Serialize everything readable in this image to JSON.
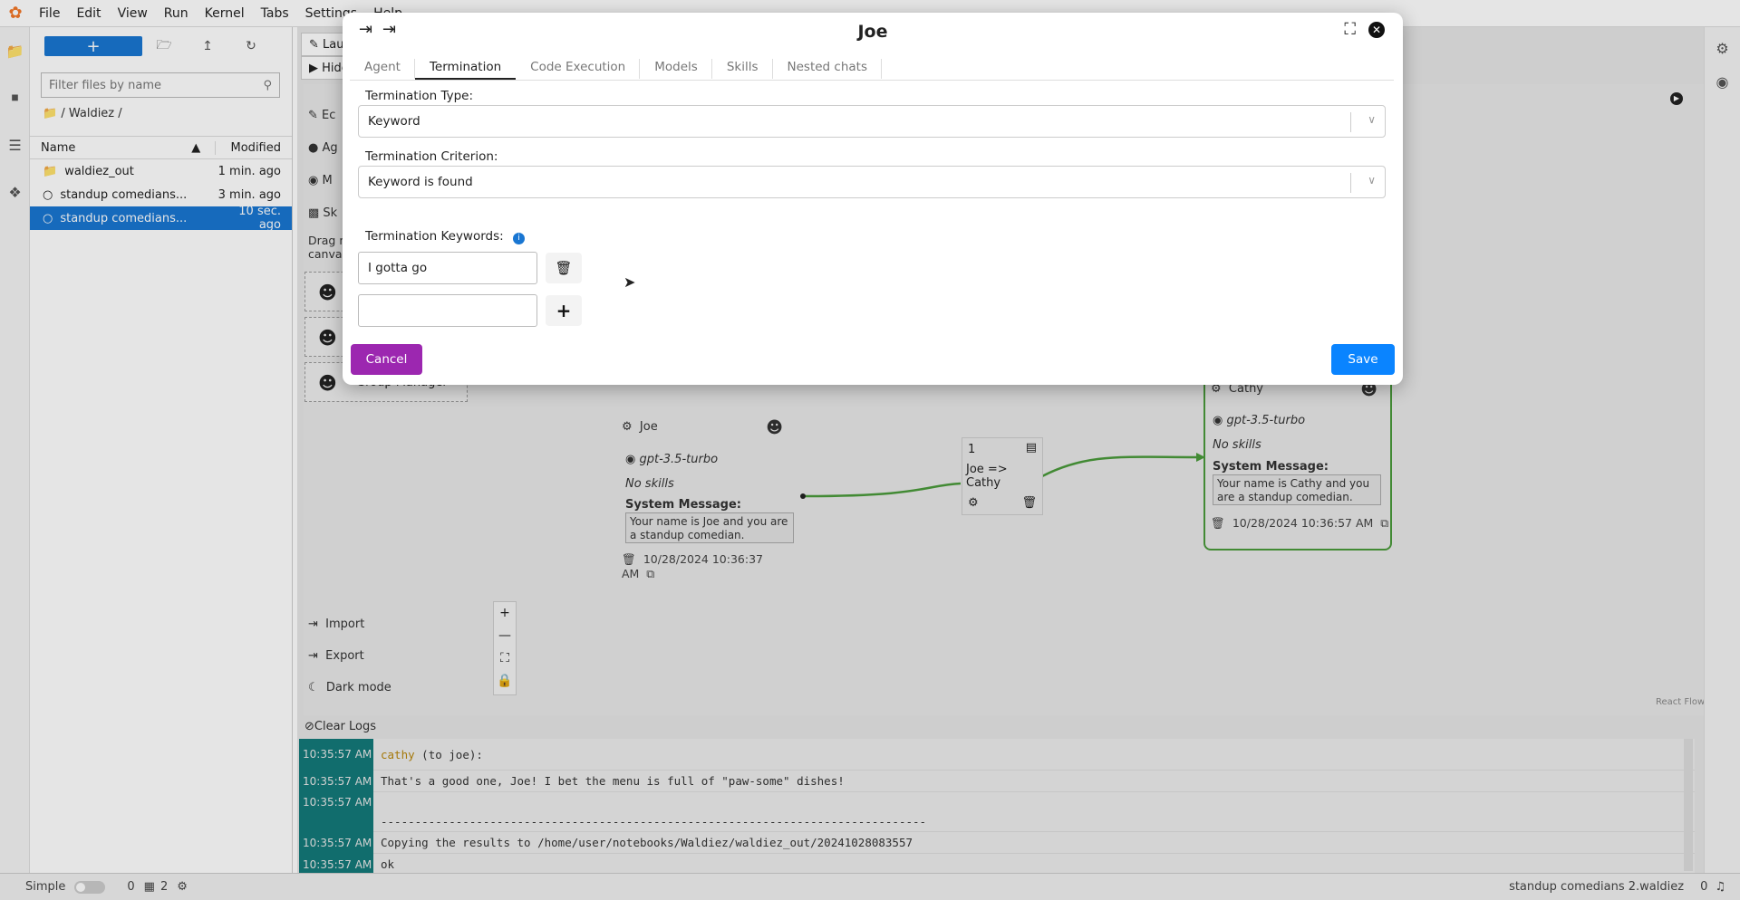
{
  "menubar": {
    "items": [
      "File",
      "Edit",
      "View",
      "Run",
      "Kernel",
      "Tabs",
      "Settings",
      "Help"
    ]
  },
  "filebrowser": {
    "filter_placeholder": "Filter files by name",
    "breadcrumb": "/ Waldiez /",
    "col_name": "Name",
    "col_modified": "Modified",
    "rows": [
      {
        "name": "waldiez_out",
        "modified": "1 min. ago"
      },
      {
        "name": "standup comedians...",
        "modified": "3 min. ago"
      },
      {
        "name": "standup comedians...",
        "modified": "10 sec. ago"
      }
    ]
  },
  "tabs": {
    "launcher": "Lau",
    "hidden": "Hide"
  },
  "sidepanel": {
    "drag_text_1": "Drag n",
    "drag_text_2": "canvas",
    "partial_labels": [
      "Ec",
      "Ag",
      "M",
      "Sk"
    ],
    "group_manager": "Group Manager",
    "import": "Import",
    "export": "Export",
    "dark_mode": "Dark mode"
  },
  "canvas": {
    "joe": {
      "name": "Joe",
      "model": "gpt-3.5-turbo",
      "skills": "No skills",
      "sys_label": "System Message:",
      "sys_text": "Your name is Joe and you are a standup comedian.",
      "date": "10/28/2024 10:36:37 AM"
    },
    "cathy": {
      "name": "Cathy",
      "model": "gpt-3.5-turbo",
      "skills": "No skills",
      "sys_label": "System Message:",
      "sys_text": "Your name is Cathy and you are a standup comedian.",
      "date": "10/28/2024 10:36:57 AM"
    },
    "edge": {
      "order": "1",
      "label": "Joe => Cathy"
    },
    "react_flow": "React Flow"
  },
  "logs": {
    "clear_label": "Clear Logs",
    "rows": [
      {
        "time": "10:35:57 AM",
        "speaker": "cathy",
        "text": " (to joe):"
      },
      {
        "time": "10:35:57 AM",
        "speaker": "",
        "text": "That's a good one, Joe! I bet the menu is full of \"paw-some\" dishes!"
      },
      {
        "time": "10:35:57 AM",
        "speaker": "",
        "text": ""
      },
      {
        "time": "",
        "speaker": "",
        "text": "--------------------------------------------------------------------------------"
      },
      {
        "time": "10:35:57 AM",
        "speaker": "",
        "text": "Copying the results to /home/user/notebooks/Waldiez/waldiez_out/20241028083557"
      },
      {
        "time": "10:35:57 AM",
        "speaker": "",
        "text": "ok"
      }
    ],
    "speaker_color": "#b8860b"
  },
  "statusbar": {
    "mode": "Simple",
    "count1": "0",
    "count2": "2",
    "filename": "standup comedians 2.waldiez",
    "right_count": "0"
  },
  "modal": {
    "title": "Joe",
    "tabs": [
      "Agent",
      "Termination",
      "Code Execution",
      "Models",
      "Skills",
      "Nested chats"
    ],
    "active_tab": "Termination",
    "termination_type_label": "Termination Type:",
    "termination_type_value": "Keyword",
    "termination_criterion_label": "Termination Criterion:",
    "termination_criterion_value": "Keyword is found",
    "keywords_label": "Termination Keywords:",
    "keyword_value": "I gotta go",
    "cancel": "Cancel",
    "save": "Save"
  },
  "colors": {
    "accent": "#1976d2",
    "cancel": "#9c27b0",
    "save": "#0a84ff",
    "edge": "#4a9a3a",
    "log_time_bg": "#137a7a"
  }
}
